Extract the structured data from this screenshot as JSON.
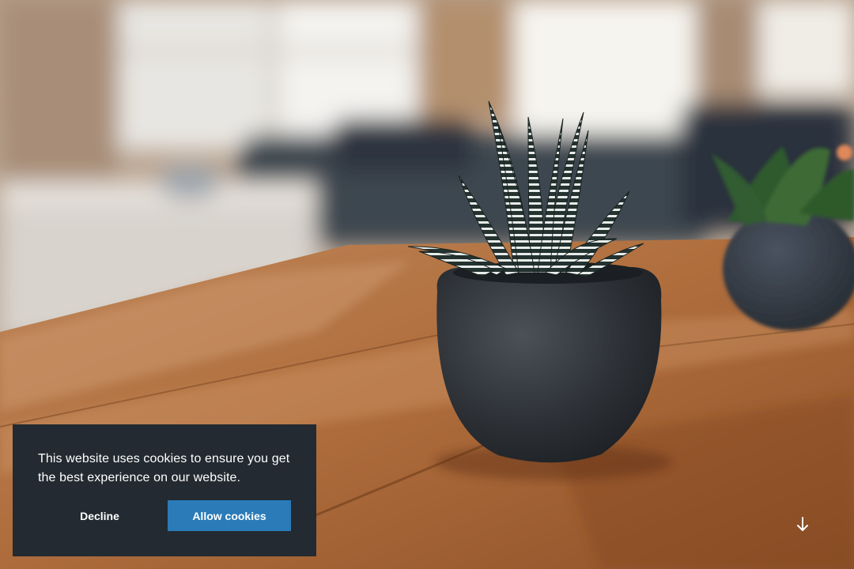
{
  "hero": {
    "background_image": "photo-potted-succulent-on-wooden-table"
  },
  "cookie_banner": {
    "message": "This website uses cookies to ensure you get the best experience on our website.",
    "decline_label": "Decline",
    "allow_label": "Allow cookies",
    "background_color": "#232a31",
    "accent_color": "#2b7bb9"
  },
  "scroll_indicator": {
    "icon": "arrow-down-icon"
  }
}
